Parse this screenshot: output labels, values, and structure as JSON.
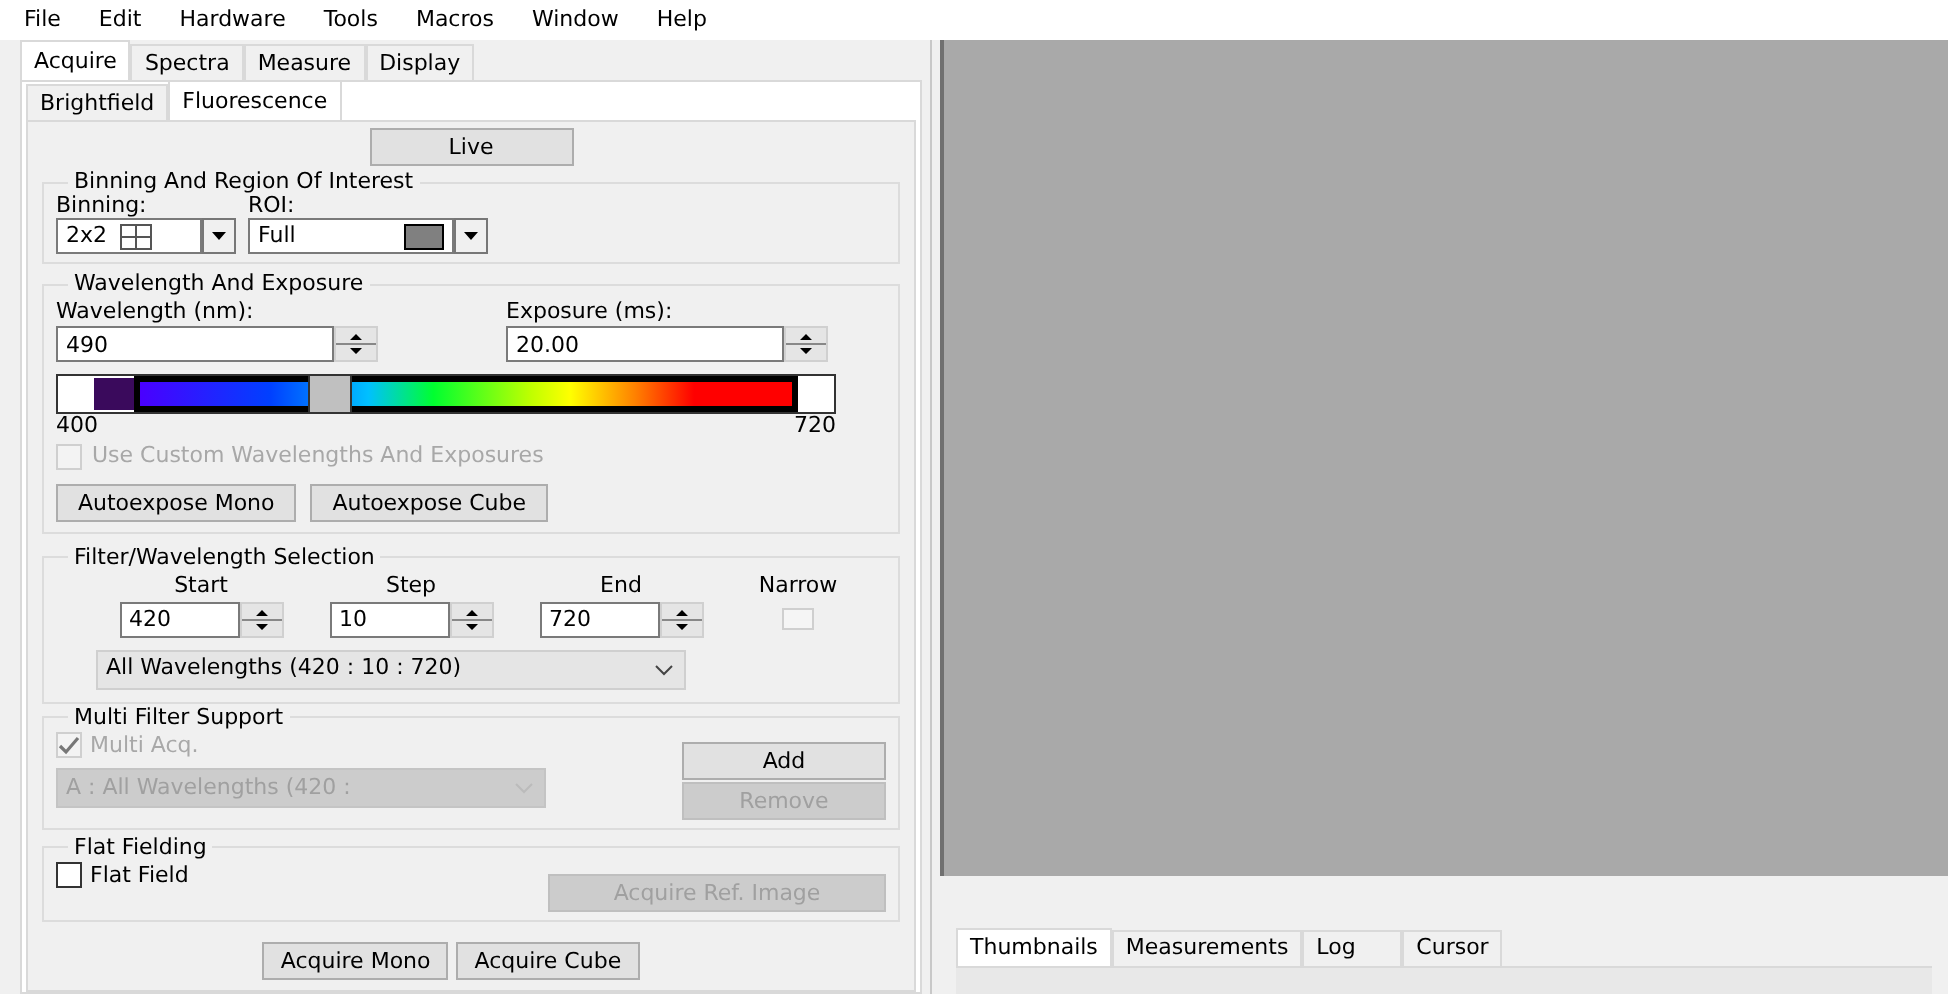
{
  "menu": [
    "File",
    "Edit",
    "Hardware",
    "Tools",
    "Macros",
    "Window",
    "Help"
  ],
  "tabs": [
    {
      "label": "Acquire",
      "selected": true
    },
    {
      "label": "Spectra",
      "selected": false
    },
    {
      "label": "Measure",
      "selected": false
    },
    {
      "label": "Display",
      "selected": false
    }
  ],
  "subtabs": [
    {
      "label": "Brightfield",
      "selected": false
    },
    {
      "label": "Fluorescence",
      "selected": true
    }
  ],
  "live_button": "Live",
  "binning_group": {
    "title": "Binning And Region Of Interest",
    "binning_label": "Binning:",
    "binning_value": "2x2",
    "roi_label": "ROI:",
    "roi_value": "Full"
  },
  "wavelength_group": {
    "title": "Wavelength And Exposure",
    "wavelength_label": "Wavelength (nm):",
    "wavelength_value": "490",
    "exposure_label": "Exposure (ms):",
    "exposure_value": "20.00",
    "slider": {
      "level": 0.28,
      "min_label": "400",
      "max_label": "720"
    },
    "custom_checkbox": {
      "label": "Use Custom Wavelengths And Exposures",
      "checked": false,
      "disabled": true
    },
    "buttons": [
      "Autoexpose Mono",
      "Autoexpose Cube"
    ]
  },
  "filter_group": {
    "title": "Filter/Wavelength Selection",
    "fields": [
      {
        "label": "Start",
        "value": "420"
      },
      {
        "label": "Step",
        "value": "10"
      },
      {
        "label": "End",
        "value": "720"
      }
    ],
    "narrow": {
      "label": "Narrow",
      "checked": false
    },
    "dropdown": "All Wavelengths (420 : 10 : 720)"
  },
  "multi_filter_group": {
    "title": "Multi Filter Support",
    "multi_acq": {
      "label": "Multi Acq.",
      "checked": true,
      "disabled": true
    },
    "dropdown": {
      "value": "A : All Wavelengths (420 :",
      "disabled": true
    },
    "buttons": [
      {
        "label": "Add",
        "disabled": false
      },
      {
        "label": "Remove",
        "disabled": true
      }
    ]
  },
  "flat_fielding_group": {
    "title": "Flat Fielding",
    "flat_field": {
      "label": "Flat Field",
      "checked": false,
      "disabled": false
    },
    "acquire_ref": {
      "label": "Acquire Ref. Image",
      "disabled": true
    }
  },
  "bottom_buttons": [
    "Acquire Mono",
    "Acquire Cube"
  ],
  "bottom_tabs": [
    {
      "label": "Thumbnails",
      "selected": true
    },
    {
      "label": "Measurements",
      "selected": false
    },
    {
      "label": "Log",
      "selected": false
    },
    {
      "label": "Cursor",
      "selected": false
    }
  ]
}
